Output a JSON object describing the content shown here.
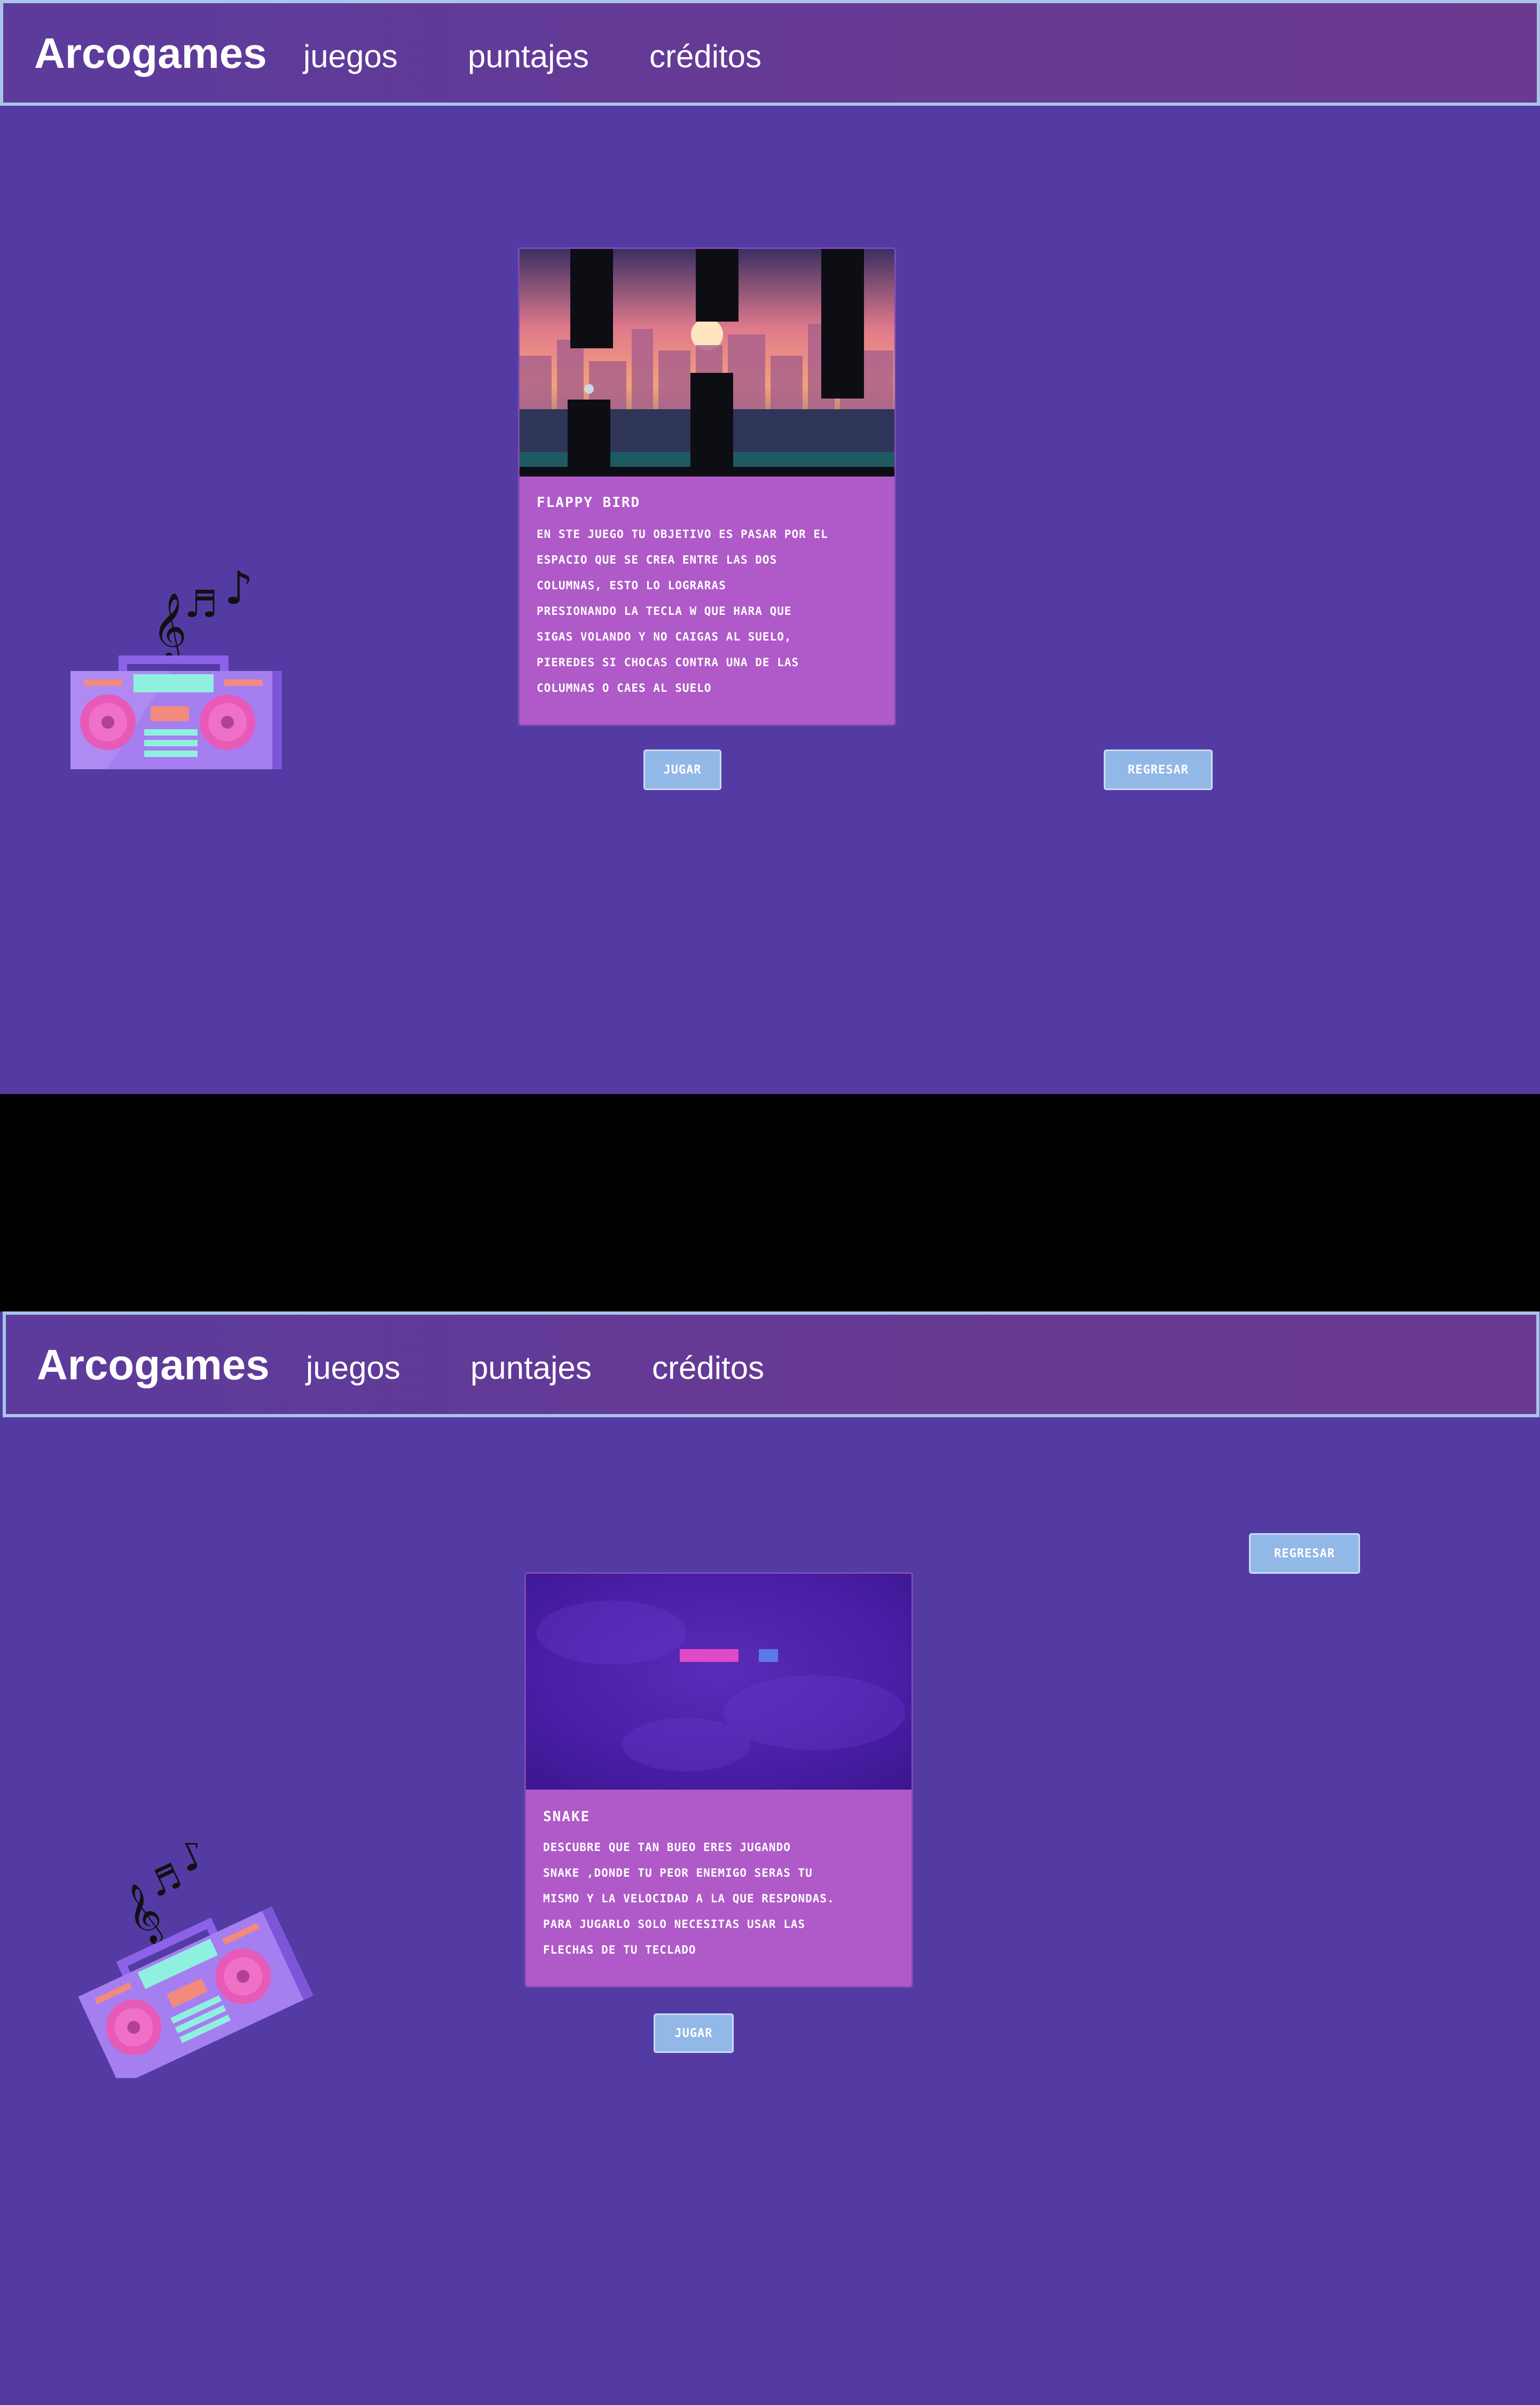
{
  "app": {
    "brand": "Arcogames"
  },
  "nav": {
    "games": "juegos",
    "scores": "puntajes",
    "credits": "créditos"
  },
  "flappy": {
    "title": "FLAPPY BIRD",
    "description": "EN STE JUEGO TU OBJETIVO ES PASAR POR EL\nESPACIO QUE SE CREA ENTRE LAS DOS\nCOLUMNAS, ESTO LO LOGRARAS\nPRESIONANDO LA TECLA W QUE HARA QUE\nSIGAS VOLANDO Y NO CAIGAS AL SUELO,\nPIEREDES SI CHOCAS CONTRA UNA DE LAS\nCOLUMNAS O CAES AL SUELO",
    "play_label": "JUGAR",
    "back_label": "REGRESAR"
  },
  "snake": {
    "title": "SNAKE",
    "description": "DESCUBRE QUE TAN BUEO ERES JUGANDO\nSNAKE ,DONDE TU PEOR ENEMIGO SERAS TU\nMISMO Y LA VELOCIDAD A LA QUE RESPONDAS.\nPARA JUGARLO SOLO NECESITAS USAR LAS\nFLECHAS DE TU TECLADO",
    "play_label": "JUGAR",
    "back_label": "REGRESAR"
  },
  "colors": {
    "background": "#533ba3",
    "navbar": "#673a93",
    "navbar_border": "#a9c4e8",
    "card": "#af5ac8",
    "button": "#92b8e8"
  }
}
